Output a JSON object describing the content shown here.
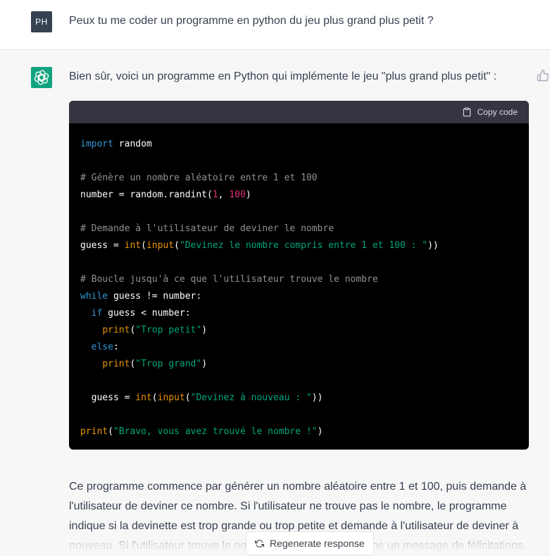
{
  "user_message": {
    "avatar_initials": "PH",
    "text": "Peux tu me coder un programme en python du jeu plus grand plus petit ?"
  },
  "assistant_message": {
    "intro": "Bien sûr, voici un programme en Python qui implémente le jeu \"plus grand plus petit\" :",
    "code_block": {
      "copy_label": "Copy code",
      "lines": [
        [
          {
            "t": "import",
            "c": "kw"
          },
          {
            "t": " random",
            "c": ""
          }
        ],
        [],
        [
          {
            "t": "# Génère un nombre aléatoire entre 1 et 100",
            "c": "cm"
          }
        ],
        [
          {
            "t": "number = random.randint(",
            "c": ""
          },
          {
            "t": "1",
            "c": "num"
          },
          {
            "t": ", ",
            "c": ""
          },
          {
            "t": "100",
            "c": "num"
          },
          {
            "t": ")",
            "c": ""
          }
        ],
        [],
        [
          {
            "t": "# Demande à l'utilisateur de deviner le nombre",
            "c": "cm"
          }
        ],
        [
          {
            "t": "guess = ",
            "c": ""
          },
          {
            "t": "int",
            "c": "bi"
          },
          {
            "t": "(",
            "c": ""
          },
          {
            "t": "input",
            "c": "bi"
          },
          {
            "t": "(",
            "c": ""
          },
          {
            "t": "\"Devinez le nombre compris entre 1 et 100 : \"",
            "c": "str"
          },
          {
            "t": "))",
            "c": ""
          }
        ],
        [],
        [
          {
            "t": "# Boucle jusqu'à ce que l'utilisateur trouve le nombre",
            "c": "cm"
          }
        ],
        [
          {
            "t": "while",
            "c": "kw"
          },
          {
            "t": " guess != number:",
            "c": ""
          }
        ],
        [
          {
            "t": "  ",
            "c": ""
          },
          {
            "t": "if",
            "c": "kw"
          },
          {
            "t": " guess < number:",
            "c": ""
          }
        ],
        [
          {
            "t": "    ",
            "c": ""
          },
          {
            "t": "print",
            "c": "bi"
          },
          {
            "t": "(",
            "c": ""
          },
          {
            "t": "\"Trop petit\"",
            "c": "str"
          },
          {
            "t": ")",
            "c": ""
          }
        ],
        [
          {
            "t": "  ",
            "c": ""
          },
          {
            "t": "else",
            "c": "kw"
          },
          {
            "t": ":",
            "c": ""
          }
        ],
        [
          {
            "t": "    ",
            "c": ""
          },
          {
            "t": "print",
            "c": "bi"
          },
          {
            "t": "(",
            "c": ""
          },
          {
            "t": "\"Trop grand\"",
            "c": "str"
          },
          {
            "t": ")",
            "c": ""
          }
        ],
        [],
        [
          {
            "t": "  guess = ",
            "c": ""
          },
          {
            "t": "int",
            "c": "bi"
          },
          {
            "t": "(",
            "c": ""
          },
          {
            "t": "input",
            "c": "bi"
          },
          {
            "t": "(",
            "c": ""
          },
          {
            "t": "\"Devinez à nouveau : \"",
            "c": "str"
          },
          {
            "t": "))",
            "c": ""
          }
        ],
        [],
        [
          {
            "t": "print",
            "c": "bi"
          },
          {
            "t": "(",
            "c": ""
          },
          {
            "t": "\"Bravo, vous avez trouvé le nombre !\"",
            "c": "str"
          },
          {
            "t": ")",
            "c": ""
          }
        ]
      ]
    },
    "explanation": "Ce programme commence par générer un nombre aléatoire entre 1 et 100, puis demande à l'utilisateur de deviner ce nombre. Si l'utilisateur ne trouve pas le nombre, le programme indique si la devinette est trop grande ou trop petite et demande à l'utilisateur de deviner à nouveau. Si l'utilisateur trouve le nombre, le programme affiche un message de félicitations."
  },
  "regenerate_label": "Regenerate response",
  "colors": {
    "user_avatar_bg": "#364152",
    "bot_avatar_bg": "#10a37f",
    "code_bg": "#000000",
    "code_header_bg": "#343541",
    "assistant_row_bg": "#f7f7f8"
  },
  "icons": {
    "bot_avatar": "openai-logo-icon",
    "feedback": "thumbs-up-icon",
    "copy": "clipboard-icon",
    "regenerate": "refresh-icon"
  }
}
